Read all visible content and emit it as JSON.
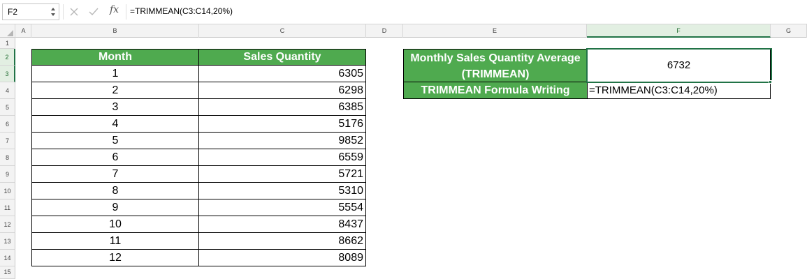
{
  "formula_bar": {
    "name_box": "F2",
    "fx_label": "fx",
    "formula": "=TRIMMEAN(C3:C14,20%)"
  },
  "columns": [
    "A",
    "B",
    "C",
    "D",
    "E",
    "F",
    "G"
  ],
  "active_column": "F",
  "rows": [
    "1",
    "2",
    "3",
    "4",
    "5",
    "6",
    "7",
    "8",
    "9",
    "10",
    "11",
    "12",
    "13",
    "14",
    "15"
  ],
  "active_row": "2",
  "sales_table": {
    "headers": [
      "Month",
      "Sales Quantity"
    ],
    "rows": [
      [
        "1",
        "6305"
      ],
      [
        "2",
        "6298"
      ],
      [
        "3",
        "6385"
      ],
      [
        "4",
        "5176"
      ],
      [
        "5",
        "9852"
      ],
      [
        "6",
        "6559"
      ],
      [
        "7",
        "5721"
      ],
      [
        "8",
        "5310"
      ],
      [
        "9",
        "5554"
      ],
      [
        "10",
        "8437"
      ],
      [
        "11",
        "8662"
      ],
      [
        "12",
        "8089"
      ]
    ]
  },
  "result": {
    "label_line1": "Monthly Sales Quantity Average",
    "label_line2": "(TRIMMEAN)",
    "value": "6732",
    "writing_label": "TRIMMEAN Formula Writing",
    "writing_value": "=TRIMMEAN(C3:C14,20%)"
  },
  "colors": {
    "header_green": "#4faa4f",
    "selection_green": "#217346"
  }
}
